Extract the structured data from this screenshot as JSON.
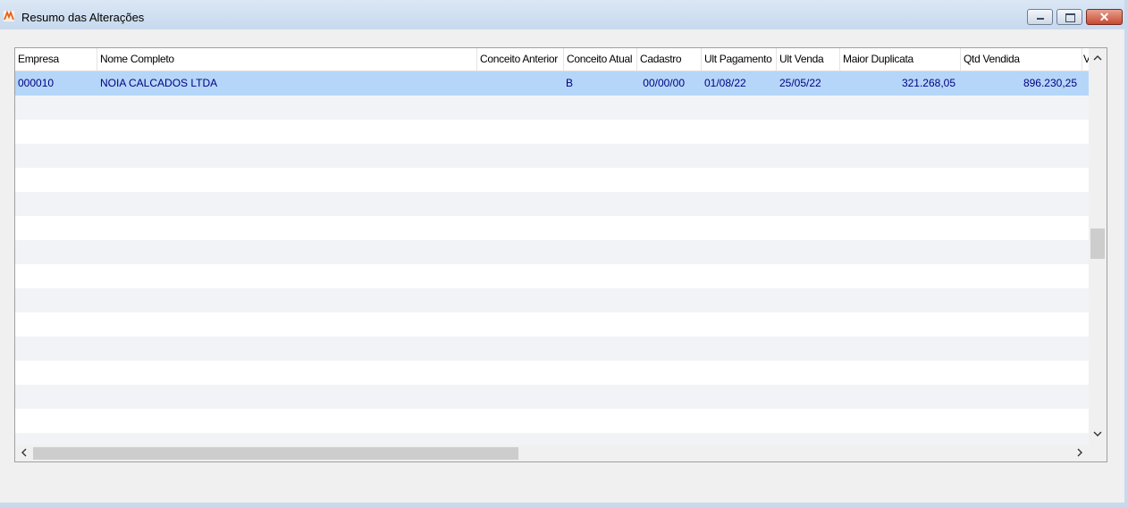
{
  "window": {
    "title": "Resumo das Alterações",
    "icon": "app-logo-icon",
    "controls": {
      "minimize": "minimize-icon",
      "maximize": "maximize-icon",
      "close": "close-icon"
    }
  },
  "grid": {
    "columns": [
      "Empresa",
      "Nome Completo",
      "Conceito Anterior",
      "Conceito Atual",
      "Cadastro",
      "Ult Pagamento",
      "Ult Venda",
      "Maior Duplicata",
      "Qtd Vendida",
      "V"
    ],
    "rows": [
      {
        "empresa": "000010",
        "nome": "NOIA CALCADOS LTDA",
        "conceito_anterior": "",
        "conceito_atual": "B",
        "cadastro": "00/00/00",
        "ult_pagamento": "01/08/22",
        "ult_venda": "25/05/22",
        "maior_duplicata": "321.268,05",
        "qtd_vendida": "896.230,25"
      }
    ],
    "selected_row": 0
  },
  "scrollbars": {
    "up": "▲",
    "down": "▼",
    "left": "<",
    "right": ">"
  },
  "colors": {
    "selected_row": "#b5d6f9",
    "data_text": "#000080",
    "alt_row": "#f2f3f7"
  }
}
